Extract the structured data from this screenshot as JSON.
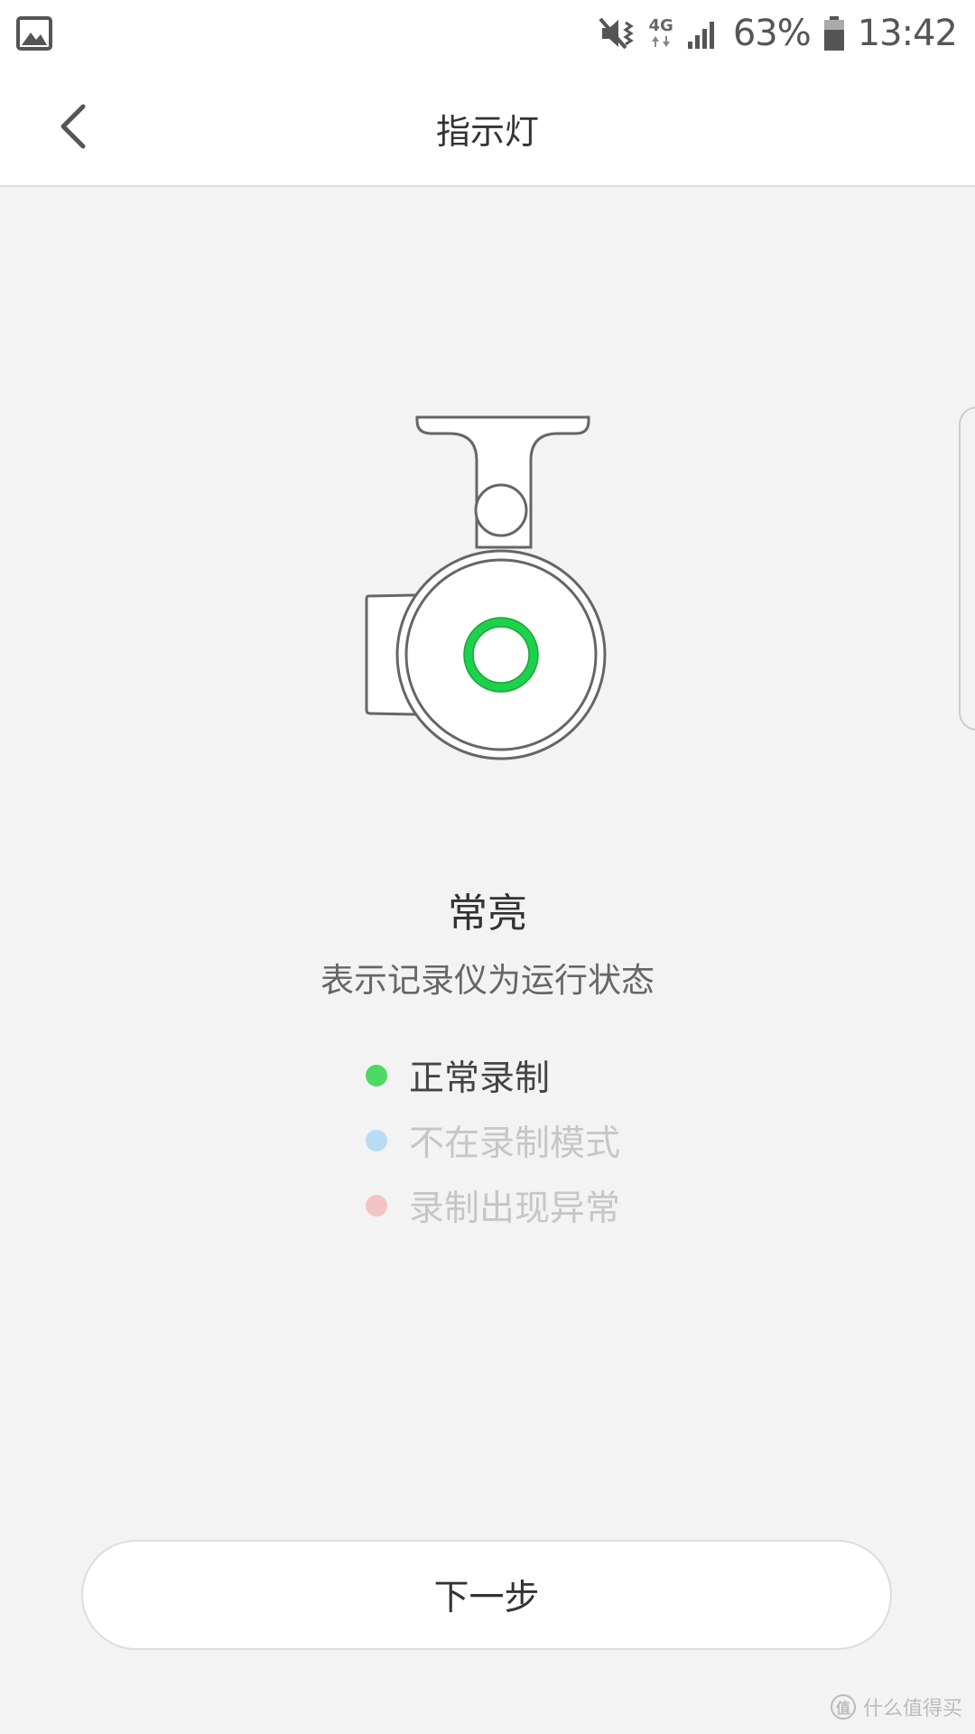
{
  "status_bar": {
    "network_label": "4G",
    "battery_percent": "63%",
    "time": "13:42",
    "icons": [
      "gallery-icon",
      "mute-vibrate-icon",
      "network-4g-icon",
      "signal-icon",
      "battery-icon"
    ]
  },
  "header": {
    "title": "指示灯",
    "back_icon": "chevron-left-icon"
  },
  "indicator": {
    "heading": "常亮",
    "description": "表示记录仪为运行状态",
    "ring_color": "#1ed14b"
  },
  "legend": [
    {
      "label": "正常录制",
      "dot_color": "#4cd964",
      "text_color": "#444444"
    },
    {
      "label": "不在录制模式",
      "dot_color": "#b9dcf5",
      "text_color": "#c6c6c6"
    },
    {
      "label": "录制出现异常",
      "dot_color": "#f3c3c3",
      "text_color": "#c6c6c6"
    }
  ],
  "next_button": {
    "label": "下一步"
  },
  "watermark": {
    "logo_text": "值",
    "text": "什么值得买"
  }
}
